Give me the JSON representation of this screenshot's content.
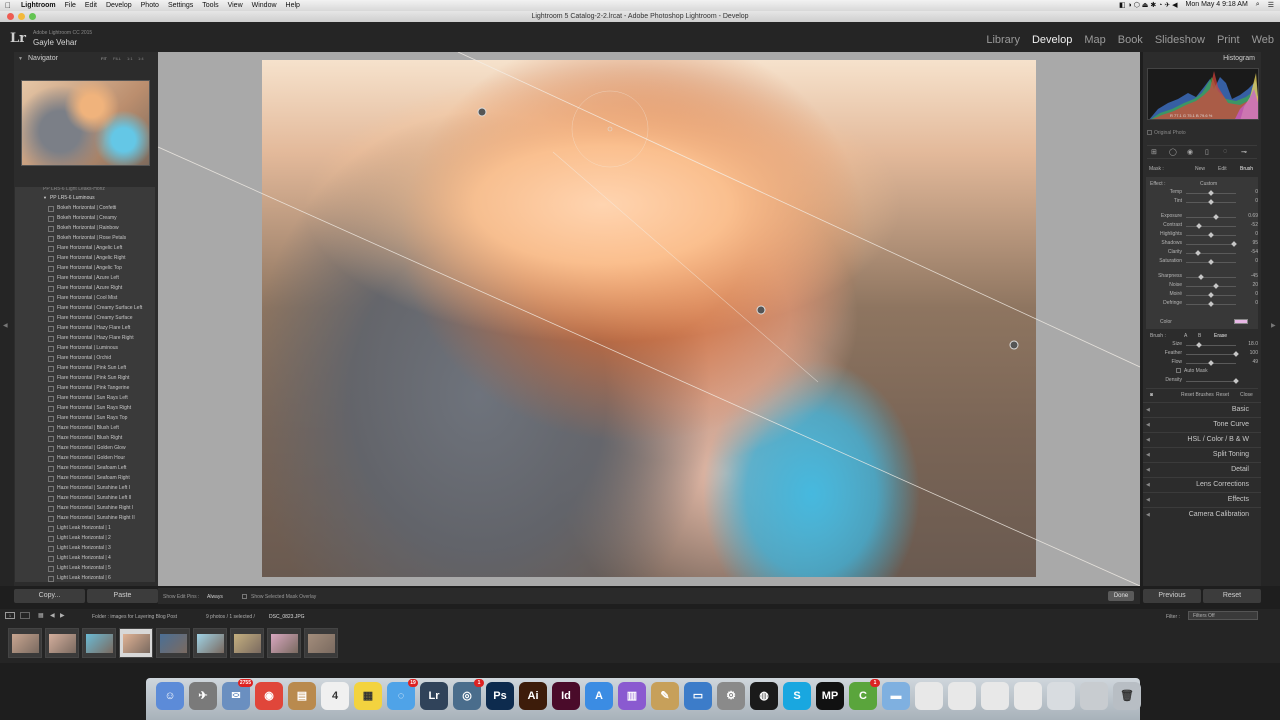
{
  "menubar": {
    "app": "Lightroom",
    "items": [
      "File",
      "Edit",
      "Develop",
      "Photo",
      "Settings",
      "Tools",
      "View",
      "Window",
      "Help"
    ],
    "clock": "Mon May 4  9:18 AM"
  },
  "window": {
    "title": "Lightroom 5 Catalog-2-2.lrcat - Adobe Photoshop Lightroom - Develop"
  },
  "identity": {
    "logo": "Lr",
    "product": "Adobe Lightroom CC 2015",
    "user": "Gayle Vehar"
  },
  "modules": [
    "Library",
    "Develop",
    "Map",
    "Book",
    "Slideshow",
    "Print",
    "Web"
  ],
  "navigator": {
    "title": "Navigator",
    "zoom_options": [
      "FIT",
      "FILL",
      "1:1",
      "1:4"
    ]
  },
  "presets": {
    "folder_prev": "PP LR5-6 Light Leaks-Horiz",
    "folder": "PP LR5-6 Luminous",
    "items": [
      "Bokeh Horizontal | Confetti",
      "Bokeh Horizontal | Creamy",
      "Bokeh Horizontal | Rainbow",
      "Bokeh Horizontal | Rose Petals",
      "Flare Horizontal | Angelic Left",
      "Flare Horizontal | Angelic Right",
      "Flare Horizontal | Angelic Top",
      "Flare Horizontal | Azure Left",
      "Flare Horizontal | Azure Right",
      "Flare Horizontal | Cool Mist",
      "Flare Horizontal | Creamy Surface Left",
      "Flare Horizontal | Creamy Surface",
      "Flare Horizontal | Hazy Flare Left",
      "Flare Horizontal | Hazy Flare Right",
      "Flare Horizontal | Luminous",
      "Flare Horizontal | Orchid",
      "Flare Horizontal | Pink Sun Left",
      "Flare Horizontal | Pink Sun Right",
      "Flare Horizontal | Pink Tangerine",
      "Flare Horizontal | Sun Rays Left",
      "Flare Horizontal | Sun Rays Right",
      "Flare Horizontal | Sun Rays Top",
      "Haze Horizontal | Blush Left",
      "Haze Horizontal | Blush Right",
      "Haze Horizontal | Golden Glow",
      "Haze Horizontal | Golden Hour",
      "Haze Horizontal | Seafoam Left",
      "Haze Horizontal | Seafoam Right",
      "Haze Horizontal | Sunshine Left I",
      "Haze Horizontal | Sunshine Left II",
      "Haze Horizontal | Sunshine Right I",
      "Haze Horizontal | Sunshine Right II",
      "Light Leak Horizontal | 1",
      "Light Leak Horizontal | 2",
      "Light Leak Horizontal | 3",
      "Light Leak Horizontal | 4",
      "Light Leak Horizontal | 5",
      "Light Leak Horizontal | 6"
    ],
    "copy_label": "Copy...",
    "paste_label": "Paste"
  },
  "toolbar": {
    "show_edit_pins_label": "Show Edit Pins :",
    "show_edit_pins_value": "Always",
    "mask_overlay_label": "Show Selected Mask Overlay",
    "done_label": "Done"
  },
  "histogram": {
    "title": "Histogram",
    "readout": "R  77.1   G  75.1   B  79.6  %",
    "original_photo": "Original Photo"
  },
  "mask": {
    "label": "Mask :",
    "new": "New",
    "edit": "Edit",
    "brush": "Brush",
    "effect_label": "Effect :",
    "effect_value": "Custom"
  },
  "adjustments": [
    {
      "label": "Temp",
      "value": "0",
      "pos": 0.5
    },
    {
      "label": "Tint",
      "value": "0",
      "pos": 0.5
    },
    {
      "label": "Exposure",
      "value": "0.69",
      "pos": 0.6
    },
    {
      "label": "Contrast",
      "value": "-52",
      "pos": 0.25
    },
    {
      "label": "Highlights",
      "value": "0",
      "pos": 0.5
    },
    {
      "label": "Shadows",
      "value": "95",
      "pos": 0.95
    },
    {
      "label": "Clarity",
      "value": "-54",
      "pos": 0.24
    },
    {
      "label": "Saturation",
      "value": "0",
      "pos": 0.5
    },
    {
      "label": "Sharpness",
      "value": "-45",
      "pos": 0.3
    },
    {
      "label": "Noise",
      "value": "20",
      "pos": 0.6
    },
    {
      "label": "Moiré",
      "value": "0",
      "pos": 0.5
    },
    {
      "label": "Defringe",
      "value": "0",
      "pos": 0.5
    }
  ],
  "color_label": "Color",
  "color_swatch": "#e8b8e6",
  "brush": {
    "label": "Brush :",
    "a": "A",
    "b": "B",
    "erase": "Erase",
    "size_label": "Size",
    "size_value": "18.0",
    "size_pos": 0.25,
    "feather_label": "Feather",
    "feather_value": "100",
    "feather_pos": 1.0,
    "flow_label": "Flow",
    "flow_value": "49",
    "flow_pos": 0.49,
    "automask_label": "Auto Mask",
    "density_label": "Density",
    "density_value": "",
    "density_pos": 1.0
  },
  "brush_footer": {
    "reset_brushes": "Reset Brushes",
    "reset": "Reset",
    "close": "Close"
  },
  "sections": [
    "Basic",
    "Tone Curve",
    "HSL  /  Color  /  B & W",
    "Split Toning",
    "Detail",
    "Lens Corrections",
    "Effects",
    "Camera Calibration"
  ],
  "right_footer": {
    "previous": "Previous",
    "reset": "Reset"
  },
  "filmstrip_bar": {
    "folder_text": "Folder : images for Layering Blog Post",
    "count_text": "9 photos / 1 selected /",
    "filename": "DSC_0823.JPG",
    "filter_label": "Filter :",
    "filter_value": "Filters Off"
  },
  "filmstrip_thumbs": [
    "#c8a590",
    "#d4ae9c",
    "#6bbbd5",
    "#e0b294",
    "#4b6f95",
    "#9fd3e6",
    "#c5b07f",
    "#d8a7c0",
    "#a38d7b"
  ],
  "dock": {
    "icons": [
      {
        "name": "finder",
        "color": "#5c8bd8",
        "glyph": "☺"
      },
      {
        "name": "launchpad",
        "color": "#7a7a7a",
        "glyph": "✈"
      },
      {
        "name": "mail",
        "color": "#6a8fc0",
        "glyph": "✉",
        "badge": "2755"
      },
      {
        "name": "chrome",
        "color": "#e0463a",
        "glyph": "◉"
      },
      {
        "name": "contacts",
        "color": "#b98a4e",
        "glyph": "▤"
      },
      {
        "name": "calendar",
        "color": "#f0f0f0",
        "glyph": "4"
      },
      {
        "name": "stickies",
        "color": "#f3d33f",
        "glyph": "▦"
      },
      {
        "name": "messages",
        "color": "#4fa3e8",
        "glyph": "◌",
        "badge": "19"
      },
      {
        "name": "lightroom",
        "color": "#30435a",
        "glyph": "Lr"
      },
      {
        "name": "camera",
        "color": "#4a6d8c",
        "glyph": "◎",
        "badge": "1"
      },
      {
        "name": "photoshop",
        "color": "#0d2b4e",
        "glyph": "Ps"
      },
      {
        "name": "illustrator",
        "color": "#3d1c0a",
        "glyph": "Ai"
      },
      {
        "name": "indesign",
        "color": "#4a0b2a",
        "glyph": "Id"
      },
      {
        "name": "appstore",
        "color": "#3b8ce3",
        "glyph": "A"
      },
      {
        "name": "ibooks",
        "color": "#8a5ad0",
        "glyph": "▥"
      },
      {
        "name": "preview",
        "color": "#c7a05a",
        "glyph": "✎"
      },
      {
        "name": "keynote",
        "color": "#3c7cc9",
        "glyph": "▭"
      },
      {
        "name": "syspref",
        "color": "#8a8a8a",
        "glyph": "⚙"
      },
      {
        "name": "quicktime",
        "color": "#1a1a1a",
        "glyph": "◍"
      },
      {
        "name": "skype",
        "color": "#19a7e0",
        "glyph": "S"
      },
      {
        "name": "mp",
        "color": "#111111",
        "glyph": "MP"
      },
      {
        "name": "evernote",
        "color": "#5aa53c",
        "glyph": "C",
        "badge": "1"
      },
      {
        "name": "folder",
        "color": "#7fb0e0",
        "glyph": "▬"
      },
      {
        "name": "docs1",
        "color": "#e8e8e8",
        "glyph": ""
      },
      {
        "name": "docs2",
        "color": "#e8e8e8",
        "glyph": ""
      },
      {
        "name": "docs3",
        "color": "#e8e8e8",
        "glyph": ""
      },
      {
        "name": "docs4",
        "color": "#e8e8e8",
        "glyph": ""
      },
      {
        "name": "docs5",
        "color": "#d8dce0",
        "glyph": ""
      },
      {
        "name": "docs6",
        "color": "#c8ccd0",
        "glyph": ""
      },
      {
        "name": "trash",
        "color": "#b8bec4",
        "glyph": "🗑"
      }
    ]
  }
}
